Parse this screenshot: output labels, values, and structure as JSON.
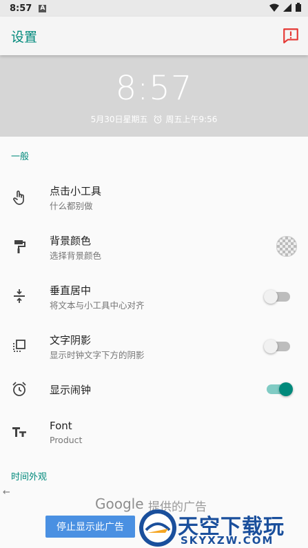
{
  "status_bar": {
    "time": "8:57",
    "notification_letter": "A"
  },
  "app_bar": {
    "title": "设置"
  },
  "clock_preview": {
    "time": "8:57",
    "date": "5月30日星期五",
    "alarm": "周五上午9:56"
  },
  "sections": {
    "general": "一般",
    "time_appearance": "时间外观"
  },
  "settings": [
    {
      "title": "点击小工具",
      "summary": "什么都别做",
      "icon": "touch-icon"
    },
    {
      "title": "背景颜色",
      "summary": "选择背景颜色",
      "icon": "paint-roller-icon"
    },
    {
      "title": "垂直居中",
      "summary": "将文本与小工具中心对齐",
      "icon": "vertical-align-center-icon",
      "switch_on": false
    },
    {
      "title": "文字阴影",
      "summary": "显示时钟文字下方的阴影",
      "icon": "shadow-icon",
      "switch_on": false
    },
    {
      "title": "显示闹钟",
      "summary": "",
      "icon": "alarm-icon",
      "switch_on": true
    },
    {
      "title": "Font",
      "summary": "Product",
      "icon": "text-fields-icon"
    }
  ],
  "ad": {
    "google": "Google",
    "provided": "提供的广告",
    "stop_button": "停止显示此广告",
    "watermark_title": "天空下载玩",
    "watermark_url": "SKYXZW.COM"
  },
  "colors": {
    "accent": "#00897b",
    "feedback": "#e53935",
    "ad_button": "#4a90e2"
  }
}
